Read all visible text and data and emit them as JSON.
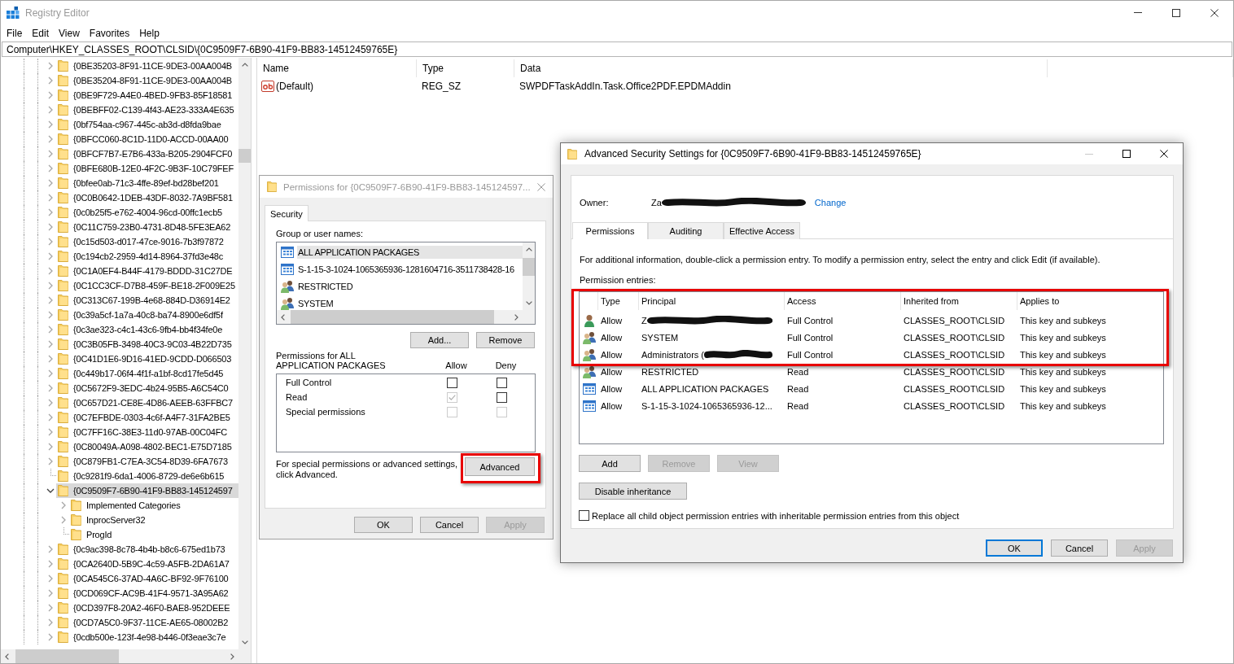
{
  "window": {
    "title": "Registry Editor",
    "active": false
  },
  "menu": [
    "File",
    "Edit",
    "View",
    "Favorites",
    "Help"
  ],
  "address": "Computer\\HKEY_CLASSES_ROOT\\CLSID\\{0C9509F7-6B90-41F9-BB83-14512459765E}",
  "tree": {
    "items": [
      {
        "label": "{0BE35203-8F91-11CE-9DE3-00AA004B",
        "has_children": true,
        "expanded": false,
        "selected": false
      },
      {
        "label": "{0BE35204-8F91-11CE-9DE3-00AA004B",
        "has_children": true,
        "expanded": false,
        "selected": false
      },
      {
        "label": "{0BE9F729-A4E0-4BED-9FB3-85F18581",
        "has_children": true,
        "expanded": false,
        "selected": false
      },
      {
        "label": "{0BEBFF02-C139-4f43-AE23-333A4E635",
        "has_children": true,
        "expanded": false,
        "selected": false
      },
      {
        "label": "{0bf754aa-c967-445c-ab3d-d8fda9bae",
        "has_children": true,
        "expanded": false,
        "selected": false
      },
      {
        "label": "{0BFCC060-8C1D-11D0-ACCD-00AA00",
        "has_children": true,
        "expanded": false,
        "selected": false
      },
      {
        "label": "{0BFCF7B7-E7B6-433a-B205-2904FCF0",
        "has_children": true,
        "expanded": false,
        "selected": false
      },
      {
        "label": "{0BFE680B-12E0-4F2C-9B3F-10C79FEF",
        "has_children": true,
        "expanded": false,
        "selected": false
      },
      {
        "label": "{0bfee0ab-71c3-4ffe-89ef-bd28bef201",
        "has_children": true,
        "expanded": false,
        "selected": false
      },
      {
        "label": "{0C0B0642-1DEB-43DF-8032-7A9BF581",
        "has_children": true,
        "expanded": false,
        "selected": false
      },
      {
        "label": "{0c0b25f5-e762-4004-96cd-00ffc1ecb5",
        "has_children": true,
        "expanded": false,
        "selected": false
      },
      {
        "label": "{0C11C759-23B0-4731-8D48-5FE3EA62",
        "has_children": true,
        "expanded": false,
        "selected": false
      },
      {
        "label": "{0c15d503-d017-47ce-9016-7b3f97872",
        "has_children": true,
        "expanded": false,
        "selected": false
      },
      {
        "label": "{0c194cb2-2959-4d14-8964-37fd3e48c",
        "has_children": true,
        "expanded": false,
        "selected": false
      },
      {
        "label": "{0C1A0EF4-B44F-4179-BDDD-31C27DE",
        "has_children": true,
        "expanded": false,
        "selected": false
      },
      {
        "label": "{0C1CC3CF-D7B8-459F-BE18-2F009E25",
        "has_children": true,
        "expanded": false,
        "selected": false
      },
      {
        "label": "{0C313C67-199B-4e68-884D-D36914E2",
        "has_children": true,
        "expanded": false,
        "selected": false
      },
      {
        "label": "{0c39a5cf-1a7a-40c8-ba74-8900e6df5f",
        "has_children": true,
        "expanded": false,
        "selected": false
      },
      {
        "label": "{0c3ae323-c4c1-43c6-9fb4-bb4f34fe0e",
        "has_children": true,
        "expanded": false,
        "selected": false
      },
      {
        "label": "{0C3B05FB-3498-40C3-9C03-4B22D735",
        "has_children": true,
        "expanded": false,
        "selected": false
      },
      {
        "label": "{0C41D1E6-9D16-41ED-9CDD-D066503",
        "has_children": true,
        "expanded": false,
        "selected": false
      },
      {
        "label": "{0c449b17-06f4-4f1f-a1bf-8cd17fe5d45",
        "has_children": true,
        "expanded": false,
        "selected": false
      },
      {
        "label": "{0C5672F9-3EDC-4b24-95B5-A6C54C0",
        "has_children": true,
        "expanded": false,
        "selected": false
      },
      {
        "label": "{0C657D21-CE8E-4D86-AEEB-63FFBC7",
        "has_children": true,
        "expanded": false,
        "selected": false
      },
      {
        "label": "{0C7EFBDE-0303-4c6f-A4F7-31FA2BE5",
        "has_children": true,
        "expanded": false,
        "selected": false
      },
      {
        "label": "{0C7FF16C-38E3-11d0-97AB-00C04FC",
        "has_children": true,
        "expanded": false,
        "selected": false
      },
      {
        "label": "{0C80049A-A098-4802-BEC1-E75D7185",
        "has_children": true,
        "expanded": false,
        "selected": false
      },
      {
        "label": "{0C879FB1-C7EA-3C54-8D39-6FA7673",
        "has_children": true,
        "expanded": false,
        "selected": false
      },
      {
        "label": "{0c9281f9-6da1-4006-8729-de6e6b615",
        "has_children": false,
        "selected": false
      },
      {
        "label": "{0C9509F7-6B90-41F9-BB83-145124597",
        "has_children": true,
        "expanded": true,
        "selected": true,
        "children": [
          {
            "label": "Implemented Categories",
            "has_children": true,
            "expanded": false,
            "selected": false
          },
          {
            "label": "InprocServer32",
            "has_children": true,
            "expanded": false,
            "selected": false
          },
          {
            "label": "ProgId",
            "has_children": false,
            "selected": false
          }
        ]
      },
      {
        "label": "{0c9ac398-8c78-4b4b-b8c6-675ed1b73",
        "has_children": true,
        "expanded": false,
        "selected": false
      },
      {
        "label": "{0CA2640D-5B9C-4c59-A5FB-2DA61A7",
        "has_children": true,
        "expanded": false,
        "selected": false
      },
      {
        "label": "{0CA545C6-37AD-4A6C-BF92-9F76100",
        "has_children": true,
        "expanded": false,
        "selected": false
      },
      {
        "label": "{0CD069CF-AC9B-41F4-9571-3A95A62",
        "has_children": true,
        "expanded": false,
        "selected": false
      },
      {
        "label": "{0CD397F8-20A2-46F0-BAE8-952DEEE",
        "has_children": true,
        "expanded": false,
        "selected": false
      },
      {
        "label": "{0CD7A5C0-9F37-11CE-AE65-08002B2",
        "has_children": true,
        "expanded": false,
        "selected": false
      },
      {
        "label": "{0cdb500e-123f-4e98-b446-0f3eae3c7e",
        "has_children": true,
        "expanded": false,
        "selected": false
      }
    ]
  },
  "values": {
    "columns": [
      "Name",
      "Type",
      "Data"
    ],
    "rows": [
      {
        "name": "(Default)",
        "type": "REG_SZ",
        "data": "SWPDFTaskAddIn.Task.Office2PDF.EPDMAddin"
      }
    ]
  },
  "permissions_dialog": {
    "title": "Permissions for {0C9509F7-6B90-41F9-BB83-145124597...",
    "active": false,
    "tabs": [
      {
        "label": "Security",
        "selected": true
      }
    ],
    "group_label": "Group or user names:",
    "principals": [
      {
        "name": "ALL APPLICATION PACKAGES",
        "kind": "package",
        "selected": true
      },
      {
        "name": "S-1-15-3-1024-1065365936-1281604716-3511738428-16",
        "kind": "package",
        "selected": false
      },
      {
        "name": "RESTRICTED",
        "kind": "group",
        "selected": false
      },
      {
        "name": "SYSTEM",
        "kind": "group",
        "selected": false
      }
    ],
    "list_buttons": [
      {
        "label": "Add..."
      },
      {
        "label": "Remove"
      }
    ],
    "rights_label": "Permissions for ALL APPLICATION PACKAGES",
    "rights_columns": [
      "Allow",
      "Deny"
    ],
    "rights": [
      {
        "name": "Full Control",
        "allow": {
          "checked": false,
          "disabled": false
        },
        "deny": {
          "checked": false,
          "disabled": false
        }
      },
      {
        "name": "Read",
        "allow": {
          "checked": true,
          "disabled": true
        },
        "deny": {
          "checked": false,
          "disabled": false
        }
      },
      {
        "name": "Special permissions",
        "allow": {
          "checked": false,
          "disabled": true
        },
        "deny": {
          "checked": false,
          "disabled": true
        }
      }
    ],
    "advanced_hint": "For special permissions or advanced settings, click Advanced.",
    "advanced_button": {
      "label": "Advanced",
      "highlighted": true
    },
    "footer_buttons": [
      {
        "label": "OK",
        "disabled": false
      },
      {
        "label": "Cancel",
        "disabled": false
      },
      {
        "label": "Apply",
        "disabled": true
      }
    ]
  },
  "advanced_dialog": {
    "title": "Advanced Security Settings for {0C9509F7-6B90-41F9-BB83-14512459765E}",
    "active": true,
    "owner": {
      "label": "Owner:",
      "name": "Za",
      "redacted": true,
      "link": "Change"
    },
    "tabs": [
      {
        "label": "Permissions",
        "selected": true
      },
      {
        "label": "Auditing",
        "selected": false
      },
      {
        "label": "Effective Access",
        "selected": false
      }
    ],
    "info": "For additional information, double-click a permission entry. To modify a permission entry, select the entry and click Edit (if available).",
    "entries_label": "Permission entries:",
    "columns": [
      "Type",
      "Principal",
      "Access",
      "Inherited from",
      "Applies to"
    ],
    "entries": [
      {
        "kind": "user",
        "type": "Allow",
        "principal": "Z",
        "redacted": true,
        "access": "Full Control",
        "inherited_from": "CLASSES_ROOT\\CLSID",
        "applies_to": "This key and subkeys",
        "highlighted": true
      },
      {
        "kind": "group",
        "type": "Allow",
        "principal": "SYSTEM",
        "redacted": false,
        "access": "Full Control",
        "inherited_from": "CLASSES_ROOT\\CLSID",
        "applies_to": "This key and subkeys",
        "highlighted": true
      },
      {
        "kind": "group",
        "type": "Allow",
        "principal": "Administrators (",
        "redacted": true,
        "access": "Full Control",
        "inherited_from": "CLASSES_ROOT\\CLSID",
        "applies_to": "This key and subkeys",
        "highlighted": true
      },
      {
        "kind": "group",
        "type": "Allow",
        "principal": "RESTRICTED",
        "redacted": false,
        "access": "Read",
        "inherited_from": "CLASSES_ROOT\\CLSID",
        "applies_to": "This key and subkeys",
        "highlighted": false
      },
      {
        "kind": "package",
        "type": "Allow",
        "principal": "ALL APPLICATION PACKAGES",
        "redacted": false,
        "access": "Read",
        "inherited_from": "CLASSES_ROOT\\CLSID",
        "applies_to": "This key and subkeys",
        "highlighted": false
      },
      {
        "kind": "package",
        "type": "Allow",
        "principal": "S-1-15-3-1024-1065365936-12...",
        "redacted": false,
        "access": "Read",
        "inherited_from": "CLASSES_ROOT\\CLSID",
        "applies_to": "This key and subkeys",
        "highlighted": false
      }
    ],
    "entry_buttons": [
      {
        "label": "Add",
        "disabled": false
      },
      {
        "label": "Remove",
        "disabled": true
      },
      {
        "label": "View",
        "disabled": true
      }
    ],
    "inheritance_button": {
      "label": "Disable inheritance"
    },
    "replace_option": {
      "label": "Replace all child object permission entries with inheritable permission entries from this object",
      "checked": false
    },
    "footer_buttons": [
      {
        "label": "OK",
        "disabled": false,
        "default": true
      },
      {
        "label": "Cancel",
        "disabled": false,
        "default": false
      },
      {
        "label": "Apply",
        "disabled": true,
        "default": false
      }
    ]
  }
}
